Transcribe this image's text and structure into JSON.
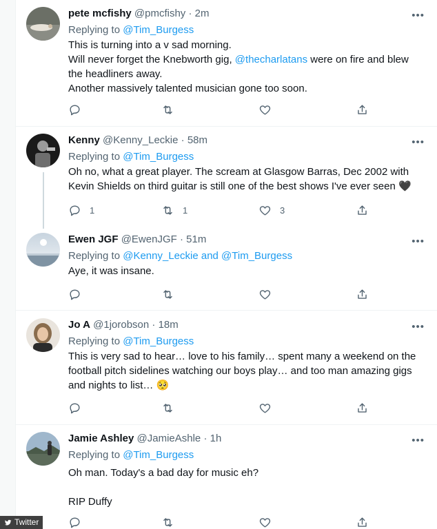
{
  "tweets": [
    {
      "name": "pete mcfishy",
      "handle": "@pmcfishy",
      "time": "2m",
      "replying_prefix": "Replying to ",
      "replying_to": "@Tim_Burgess",
      "lines": [
        {
          "before": "This is turning into a v sad morning.",
          "link": "",
          "after": ""
        },
        {
          "before": "Will never forget the Knebworth gig, ",
          "link": "@thecharlatans",
          "after": " were on fire and blew"
        },
        {
          "before": "the headliners away.",
          "link": "",
          "after": ""
        },
        {
          "before": "Another massively talented musician gone too soon.",
          "link": "",
          "after": ""
        }
      ],
      "counts": {
        "reply": "",
        "retweet": "",
        "like": ""
      }
    },
    {
      "name": "Kenny",
      "handle": "@Kenny_Leckie",
      "time": "58m",
      "replying_prefix": "Replying to ",
      "replying_to": "@Tim_Burgess",
      "lines": [
        {
          "before": "Oh no, what a great player. The scream at Glasgow Barras, Dec 2002 with",
          "link": "",
          "after": ""
        },
        {
          "before": "Kevin Shields on third guitar is still one of the best shows I've ever seen 🖤",
          "link": "",
          "after": ""
        }
      ],
      "counts": {
        "reply": "1",
        "retweet": "1",
        "like": "3"
      }
    },
    {
      "name": "Ewen JGF",
      "handle": "@EwenJGF",
      "time": "51m",
      "replying_prefix": "Replying to ",
      "replying_to": "@Kenny_Leckie and @Tim_Burgess",
      "lines": [
        {
          "before": "Aye, it was insane.",
          "link": "",
          "after": ""
        }
      ],
      "counts": {
        "reply": "",
        "retweet": "",
        "like": ""
      }
    },
    {
      "name": "Jo A",
      "handle": "@1jorobson",
      "time": "18m",
      "replying_prefix": "Replying to ",
      "replying_to": "@Tim_Burgess",
      "lines": [
        {
          "before": "This is very sad to hear… love to his family… spent many a weekend on the",
          "link": "",
          "after": ""
        },
        {
          "before": "football pitch sidelines watching our boys play… and too man amazing gigs",
          "link": "",
          "after": ""
        },
        {
          "before": "and nights to list… 🥺",
          "link": "",
          "after": ""
        }
      ],
      "counts": {
        "reply": "",
        "retweet": "",
        "like": ""
      }
    },
    {
      "name": "Jamie Ashley",
      "handle": "@JamieAshle",
      "time": "1h",
      "replying_prefix": "Replying to ",
      "replying_to": "@Tim_Burgess",
      "lines": [
        {
          "before": "Oh man. Today's a bad day for music eh?",
          "link": "",
          "after": ""
        },
        {
          "before": "",
          "link": "",
          "after": ""
        },
        {
          "before": "RIP Duffy",
          "link": "",
          "after": ""
        }
      ],
      "counts": {
        "reply": "",
        "retweet": "",
        "like": ""
      }
    }
  ],
  "ui": {
    "more_glyph": "•••",
    "dot": "·",
    "watermark": "Twitter"
  },
  "icons": {
    "reply": "reply-icon",
    "retweet": "retweet-icon",
    "like": "heart-icon",
    "share": "share-icon",
    "more": "more-icon"
  }
}
